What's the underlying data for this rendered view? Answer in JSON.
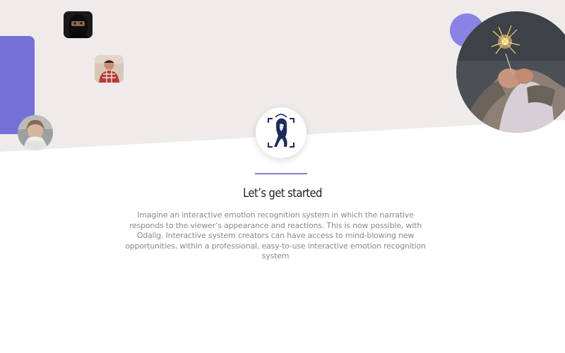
{
  "colors": {
    "accent": "#7470d8",
    "accent_light": "#8a83e3",
    "divider": "#7b7fd6",
    "top_background": "#efebeb",
    "title": "#1c1c1c",
    "body_text": "#8a8a8a"
  },
  "logo": {
    "icon": "face-scan-icon"
  },
  "content": {
    "title": "Let’s get started",
    "description": "Imagine an interactive emotion recognition system in which the narrative responds to the viewer’s appearance and reactions. This is now possible, with Odalig. Interactive system creators can have access to mind-blowing new opportunities, within a professional, easy-to-use interactive emotion recognition system"
  }
}
